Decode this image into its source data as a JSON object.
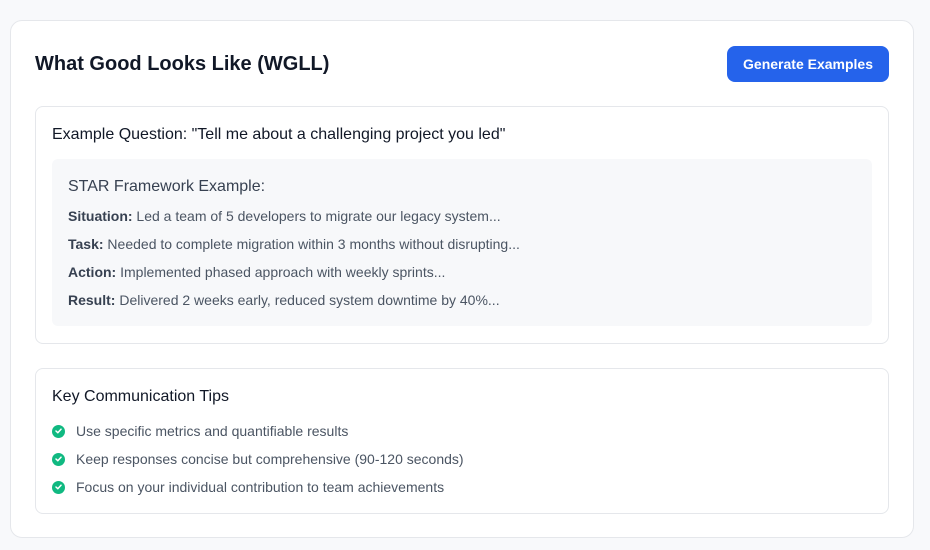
{
  "header": {
    "title": "What Good Looks Like (WGLL)",
    "generate_label": "Generate Examples"
  },
  "example": {
    "question": "Example Question: \"Tell me about a challenging project you led\"",
    "framework_title": "STAR Framework Example:",
    "items": [
      {
        "label": "Situation:",
        "text": " Led a team of 5 developers to migrate our legacy system..."
      },
      {
        "label": "Task:",
        "text": " Needed to complete migration within 3 months without disrupting..."
      },
      {
        "label": "Action:",
        "text": " Implemented phased approach with weekly sprints..."
      },
      {
        "label": "Result:",
        "text": " Delivered 2 weeks early, reduced system downtime by 40%..."
      }
    ]
  },
  "tips": {
    "title": "Key Communication Tips",
    "items": [
      "Use specific metrics and quantifiable results",
      "Keep responses concise but comprehensive (90-120 seconds)",
      "Focus on your individual contribution to team achievements"
    ],
    "icon": "check-circle-icon"
  },
  "colors": {
    "accent": "#2563eb",
    "check": "#10b981"
  }
}
